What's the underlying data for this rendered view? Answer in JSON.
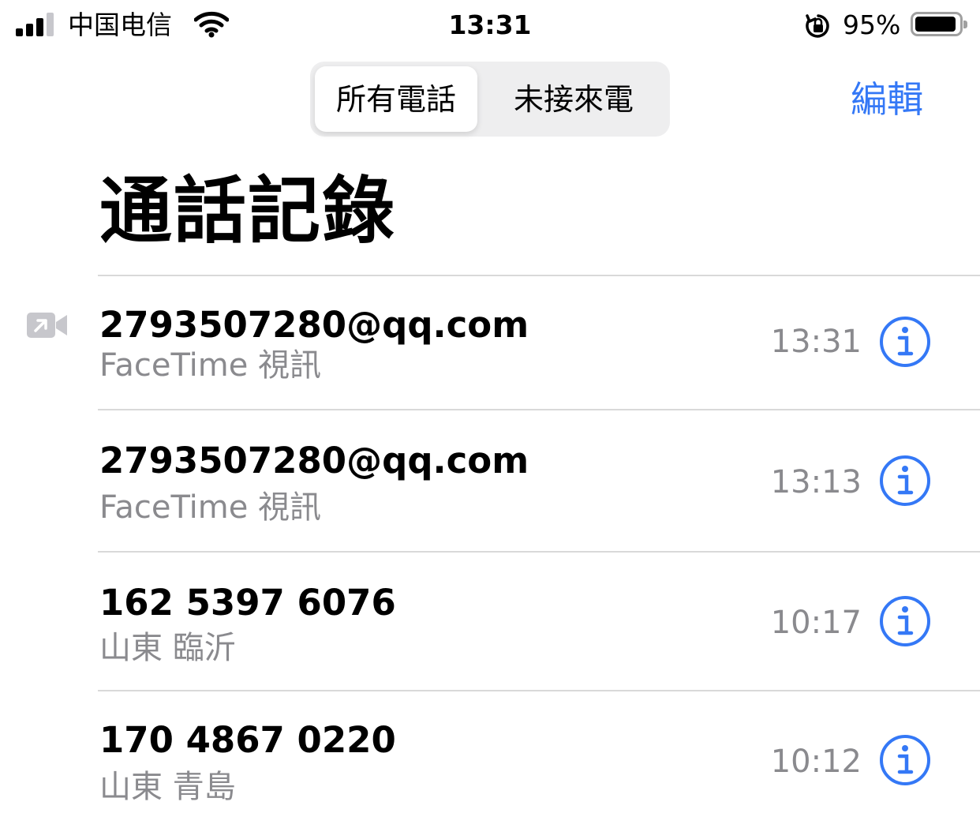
{
  "status_bar": {
    "carrier": "中国电信",
    "time": "13:31",
    "battery_percent": "95%",
    "battery_level": 0.95
  },
  "segmented_control": {
    "options": [
      "所有電話",
      "未接來電"
    ],
    "selected": "所有電話"
  },
  "header": {
    "edit_label": "編輯",
    "title": "通話記錄"
  },
  "calls": [
    {
      "contact": "2793507280@qq.com",
      "subtitle": "FaceTime 視訊",
      "time": "13:31",
      "icon": "facetime-outgoing-icon"
    },
    {
      "contact": "2793507280@qq.com",
      "subtitle": "FaceTime 視訊",
      "time": "13:13"
    },
    {
      "contact": "162 5397 6076",
      "subtitle": "山東 臨沂",
      "time": "10:17"
    },
    {
      "contact": "170 4867 0220",
      "subtitle": "山東 青島",
      "time": "10:12"
    }
  ],
  "colors": {
    "accent": "#3478f6",
    "secondary_text": "#8a8a8e",
    "separator": "#d9d9d9",
    "segment_background": "#eeeeef"
  }
}
